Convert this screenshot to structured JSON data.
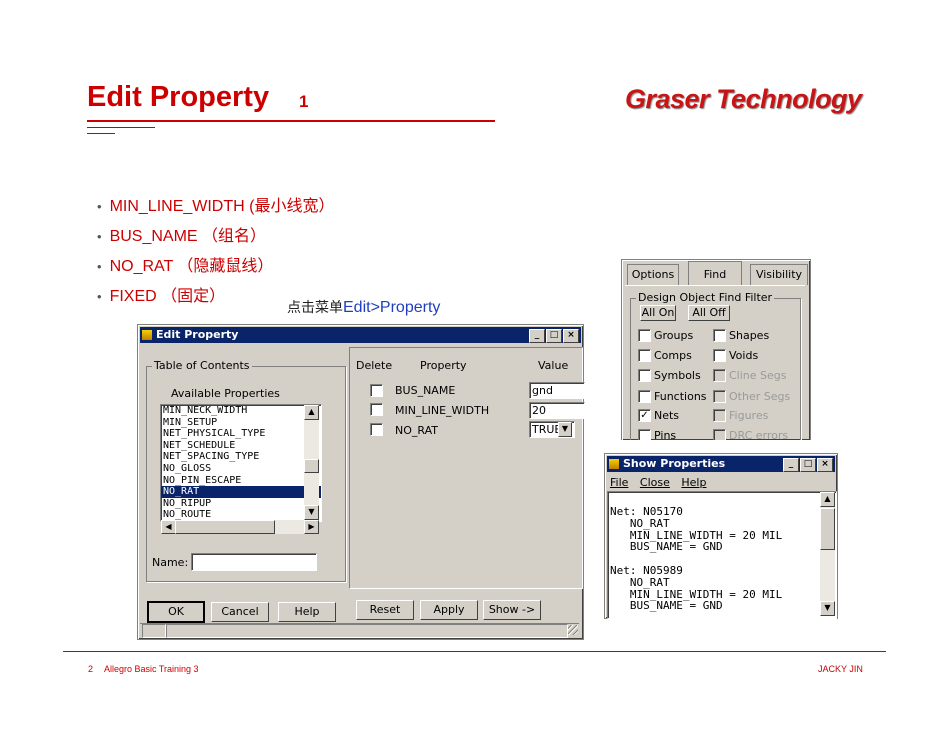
{
  "slide": {
    "title": "Edit Property",
    "title_number": "1",
    "logo_text": "Graser Technology",
    "bullets": [
      "MIN_LINE_WIDTH (最小线宽）",
      "BUS_NAME （组名）",
      "NO_RAT （隐藏鼠线）",
      "FIXED （固定）"
    ],
    "instruction_prefix": "点击菜单",
    "instruction_menu": "Edit>Property",
    "footer_page": "2",
    "footer_course": "Allegro Basic Training 3",
    "footer_author": "JACKY JIN"
  },
  "edit_property": {
    "title": "Edit Property",
    "toc_label": "Table of Contents",
    "available_label": "Available Properties",
    "properties_list": [
      "MIN_NECK_WIDTH",
      "MIN_SETUP",
      "NET_PHYSICAL_TYPE",
      "NET_SCHEDULE",
      "NET_SPACING_TYPE",
      "NO_GLOSS",
      "NO_PIN_ESCAPE",
      "NO_RAT",
      "NO_RIPUP",
      "NO_ROUTE"
    ],
    "selected_property": "NO_RAT",
    "name_label": "Name:",
    "name_value": "",
    "col_delete": "Delete",
    "col_property": "Property",
    "col_value": "Value",
    "rows": [
      {
        "property": "BUS_NAME",
        "value": "gnd"
      },
      {
        "property": "MIN_LINE_WIDTH",
        "value": "20"
      },
      {
        "property": "NO_RAT",
        "value": "TRUE"
      }
    ],
    "buttons": {
      "ok": "OK",
      "cancel": "Cancel",
      "help": "Help",
      "reset": "Reset",
      "apply": "Apply",
      "show": "Show ->"
    }
  },
  "find_panel": {
    "tabs": [
      "Options",
      "Find",
      "Visibility"
    ],
    "filter_label": "Design Object Find Filter",
    "all_on": "All On",
    "all_off": "All Off",
    "left_items": [
      {
        "label": "Groups",
        "checked": false
      },
      {
        "label": "Comps",
        "checked": false
      },
      {
        "label": "Symbols",
        "checked": false
      },
      {
        "label": "Functions",
        "checked": false
      },
      {
        "label": "Nets",
        "checked": true
      },
      {
        "label": "Pins",
        "checked": false
      }
    ],
    "right_items": [
      {
        "label": "Shapes",
        "disabled": false
      },
      {
        "label": "Voids",
        "disabled": false
      },
      {
        "label": "Cline Segs",
        "disabled": true
      },
      {
        "label": "Other Segs",
        "disabled": true
      },
      {
        "label": "Figures",
        "disabled": true
      },
      {
        "label": "DRC errors",
        "disabled": true
      }
    ]
  },
  "show_properties": {
    "title": "Show Properties",
    "menu": [
      "File",
      "Close",
      "Help"
    ],
    "text_lines": [
      "Net: N05170",
      "   NO_RAT",
      "   MIN_LINE_WIDTH = 20 MIL",
      "   BUS_NAME = GND",
      "",
      "Net: N05989",
      "   NO_RAT",
      "   MIN_LINE_WIDTH = 20 MIL",
      "   BUS_NAME = GND"
    ]
  },
  "colors": {
    "accent_red": "#cc0000",
    "titlebar_blue": "#0a246a",
    "window_gray": "#d4d0c8",
    "link_blue": "#1f3fbf"
  }
}
